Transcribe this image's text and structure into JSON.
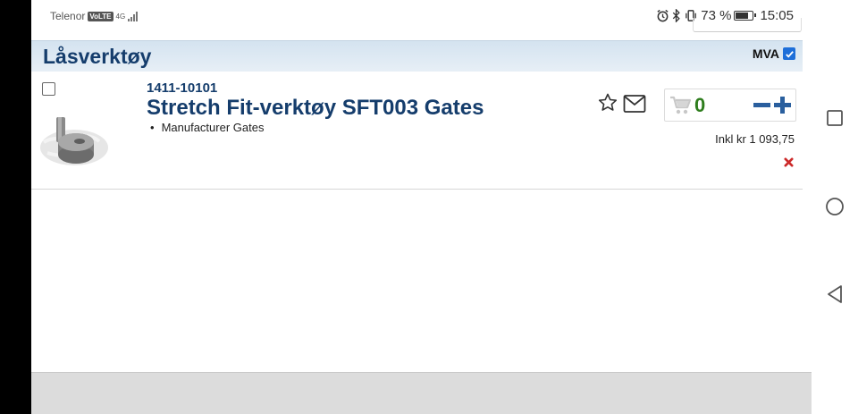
{
  "status_bar": {
    "carrier": "Telenor",
    "volte": "VoLTE",
    "network": "4G",
    "battery_percent": "73 %",
    "time": "15:05",
    "battery_level": 0.73
  },
  "header": {
    "title": "Låsverktøy",
    "mva_label": "MVA",
    "mva_checked": true
  },
  "product": {
    "sku": "1411-10101",
    "name": "Stretch Fit-verktøy SFT003 Gates",
    "attributes": [
      "Manufacturer Gates"
    ],
    "quantity": "0",
    "price_label": "Inkl kr 1 093,75",
    "selected": false
  },
  "colors": {
    "brand_blue": "#153d6c",
    "header_bg": "#dbe7f2",
    "qty_green": "#2e7d1d",
    "qty_button_blue": "#2a5f9e",
    "remove_red": "#cc2a2a",
    "checkbox_blue": "#1e6fd9"
  },
  "icons": {
    "favorite": "star-outline-icon",
    "email": "envelope-icon",
    "cart": "shopping-cart-icon",
    "decrease": "minus-icon",
    "increase": "plus-icon",
    "remove": "remove-x-icon"
  }
}
